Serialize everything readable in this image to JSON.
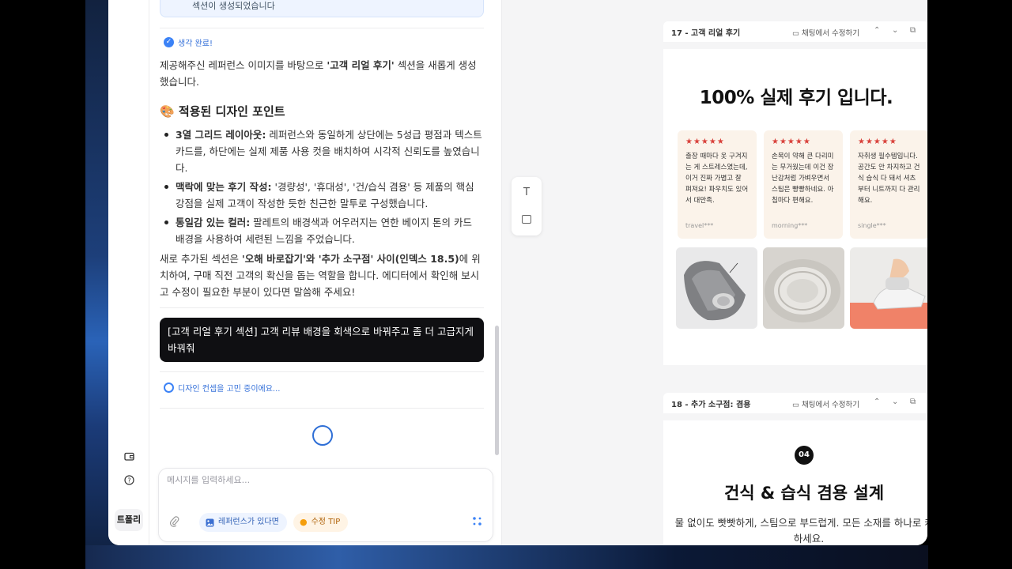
{
  "rail": {
    "user_label": "트폴리"
  },
  "chat": {
    "notice_text": "섹션이 생성되었습니다",
    "done_label": "생각 완료!",
    "intro_pre": "제공해주신 레퍼런스 이미지를 바탕으로 ",
    "intro_bold": "'고객 리얼 후기'",
    "intro_post": " 섹션을 새롭게 생성했습니다.",
    "heading_emoji": "🎨",
    "heading": "적용된 디자인 포인트",
    "bullets": [
      {
        "bold": "3열 그리드 레이아웃:",
        "text": " 레퍼런스와 동일하게 상단에는 5성급 평점과 텍스트 카드를, 하단에는 실제 제품 사용 컷을 배치하여 시각적 신뢰도를 높였습니다."
      },
      {
        "bold": "맥락에 맞는 후기 작성:",
        "text": " '경량성', '휴대성', '건/습식 겸용' 등 제품의 핵심 강점을 실제 고객이 작성한 듯한 친근한 말투로 구성했습니다."
      },
      {
        "bold": "통일감 있는 컬러:",
        "text": " 팔레트의 배경색과 어우러지는 연한 베이지 톤의 카드 배경을 사용하여 세련된 느낌을 주었습니다."
      }
    ],
    "outro_pre": "새로 추가된 섹션은 ",
    "outro_bold": "'오해 바로잡기'와 '추가 소구점' 사이(인덱스 18.5)",
    "outro_post": "에 위치하여, 구매 직전 고객의 확신을 돕는 역할을 합니다. 에디터에서 확인해 보시고 수정이 필요한 부분이 있다면 말씀해 주세요!",
    "user_message": "[고객 리얼 후기 섹션] 고객 리뷰 배경을 회색으로 바꿔주고 좀 더 고급지게 바꿔줘",
    "thinking_label": "디자인 컨셉을 고민 중이에요...",
    "input_placeholder": "메시지를 입력하세요...",
    "chip_reference": "레퍼런스가 있다면",
    "chip_tip": "수정 TIP"
  },
  "canvas": {
    "section1": {
      "header_title": "17 - 고객 리얼 후기",
      "edit_label": "채팅에서 수정하기",
      "title": "100% 실제 후기 입니다.",
      "stars": "★★★★★",
      "reviews": [
        {
          "text": "출장 때마다 옷 구겨지는 게 스트레스였는데, 이거 진짜 가볍고 잘 펴져요! 파우치도 있어서 대만족.",
          "user": "travel***"
        },
        {
          "text": "손목이 약해 큰 다리미는 무거웠는데 이건 장난감처럼 가벼우면서 스팀은 빵빵하네요. 아침마다 편해요.",
          "user": "morning***"
        },
        {
          "text": "자취생 필수템입니다. 공간도 안 차지하고 건식 습식 다 돼서 셔츠부터 니트까지 다 관리해요.",
          "user": "single***"
        }
      ]
    },
    "section2": {
      "header_title": "18 - 추가 소구점: 겸용",
      "edit_label": "채팅에서 수정하기",
      "badge": "04",
      "title": "건식 & 습식 겸용 설계",
      "desc": "물 없이도 빳빳하게, 스팀으로 부드럽게. 모든 소재를 하나로 케어하세요."
    }
  },
  "colors": {
    "accent_blue": "#3b82f6",
    "review_card_bg": "#fbf3ea",
    "star_red": "#d8403a",
    "user_bubble": "#0f0f12"
  }
}
